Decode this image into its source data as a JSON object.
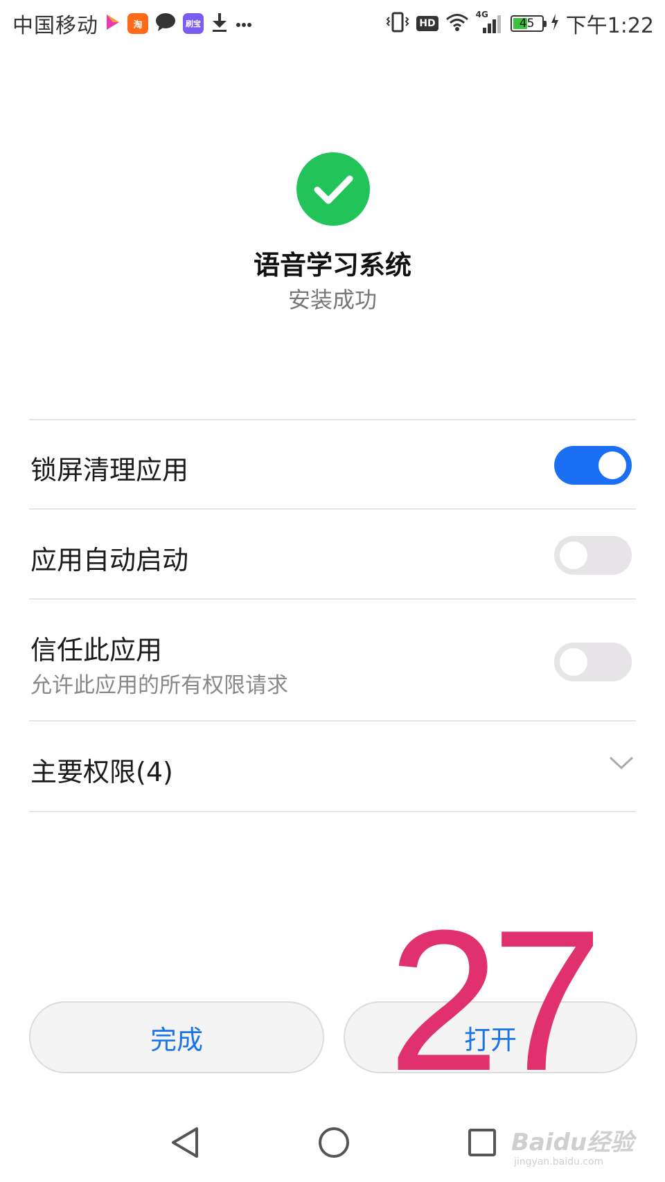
{
  "status_bar": {
    "carrier": "中国移动",
    "notification_icons": [
      "video-play-icon",
      "taobao-app-icon",
      "chat-bubble-icon",
      "app-badge-icon",
      "download-icon",
      "more-icon"
    ],
    "app_badge_text": "淘",
    "app_badge2_text": "刷宝",
    "network_label": "4G",
    "hd_label": "HD",
    "battery_level": "45",
    "time": "下午1:22"
  },
  "install_result": {
    "app_name": "语音学习系统",
    "status": "安装成功"
  },
  "settings": [
    {
      "label": "锁屏清理应用",
      "enabled": true
    },
    {
      "label": "应用自动启动",
      "enabled": false
    },
    {
      "label": "信任此应用",
      "subtitle": "允许此应用的所有权限请求",
      "enabled": false
    }
  ],
  "permissions": {
    "label": "主要权限(4)"
  },
  "buttons": {
    "done": "完成",
    "open": "打开"
  },
  "overlay_number": "27",
  "watermark": {
    "brand": "Baidu经验",
    "url": "jingyan.baidu.com"
  },
  "colors": {
    "success": "#22c45a",
    "accent": "#1a73e8",
    "toggle_on": "#1a6ff2",
    "toggle_off": "#e6e4e6",
    "overlay": "#e0306e"
  }
}
